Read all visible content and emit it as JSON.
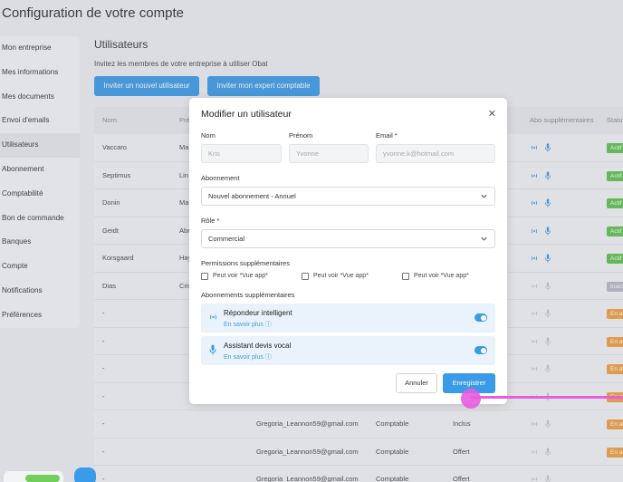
{
  "page_title": "Configuration de votre compte",
  "sidebar": {
    "items": [
      {
        "label": "Mon entreprise"
      },
      {
        "label": "Mes informations"
      },
      {
        "label": "Mes documents"
      },
      {
        "label": "Envoi d'emails"
      },
      {
        "label": "Utilisateurs"
      },
      {
        "label": "Abonnement"
      },
      {
        "label": "Comptabilité"
      },
      {
        "label": "Bon de commande"
      },
      {
        "label": "Banques"
      },
      {
        "label": "Compte"
      },
      {
        "label": "Notifications"
      },
      {
        "label": "Préférences"
      }
    ]
  },
  "main": {
    "title": "Utilisateurs",
    "subtitle": "Invitez les membres de votre entreprise à utiliser Obat",
    "invite_user_label": "Inviter un nouvel utilisateur",
    "invite_expert_label": "Inviter mon expert comptable"
  },
  "table": {
    "headers": {
      "nom": "Nom",
      "prenom": "Pré",
      "abo": "Abo supplémentaires",
      "statut": "Statu"
    },
    "rows": [
      {
        "nom": "Vaccaro",
        "prenom": "Ma",
        "email": "",
        "role": "",
        "abo": "",
        "statut": "Actif"
      },
      {
        "nom": "Septimus",
        "prenom": "Lin",
        "email": "",
        "role": "",
        "abo": "",
        "statut": "Actif"
      },
      {
        "nom": "Donin",
        "prenom": "Ma",
        "email": "",
        "role": "",
        "abo": "",
        "statut": "Actif"
      },
      {
        "nom": "Geidt",
        "prenom": "Abr",
        "email": "",
        "role": "",
        "abo": "",
        "statut": "Actif"
      },
      {
        "nom": "Korsgaard",
        "prenom": "Hay",
        "email": "",
        "role": "",
        "abo": "",
        "statut": "Actif"
      },
      {
        "nom": "Dias",
        "prenom": "Cris",
        "email": "",
        "role": "",
        "abo": "",
        "statut": "Inact"
      },
      {
        "nom": "-",
        "prenom": "",
        "email": "",
        "role": "",
        "abo": "",
        "statut": "En at"
      },
      {
        "nom": "-",
        "prenom": "",
        "email": "",
        "role": "",
        "abo": "",
        "statut": "En at"
      },
      {
        "nom": "-",
        "prenom": "",
        "email": "",
        "role": "",
        "abo": "",
        "statut": "En at"
      },
      {
        "nom": "-",
        "prenom": "",
        "email": "",
        "role": "",
        "abo": "",
        "statut": "En at"
      },
      {
        "nom": "-",
        "prenom": "",
        "email": "Gregoria_Leannon59@gmail.com",
        "role": "Comptable",
        "abo": "Inclus",
        "statut": "En at"
      },
      {
        "nom": "-",
        "prenom": "",
        "email": "Gregoria_Leannon59@gmail.com",
        "role": "Comptable",
        "abo": "Offert",
        "statut": "En at"
      },
      {
        "nom": "-",
        "prenom": "",
        "email": "Gregoria_Leannon59@gmail.com",
        "role": "Comptable",
        "abo": "Offert",
        "statut": ""
      }
    ]
  },
  "modal": {
    "title": "Modifier un utilisateur",
    "nom_label": "Nom",
    "nom_value": "Kris",
    "prenom_label": "Prénom",
    "prenom_value": "Yvonne",
    "email_label": "Email *",
    "email_value": "yvonne.k@hotmail.com",
    "abonnement_label": "Abonnement",
    "abonnement_value": "Nouvel abonnement - Annuel",
    "role_label": "Rôle *",
    "role_value": "Commercial",
    "permissions_label": "Permissions supplémentaires",
    "permissions": [
      "Peut voir *Vue app*",
      "Peut voir *Vue app*",
      "Peut voir *Vue app*"
    ],
    "abonnements_label": "Abonnements supplémentaires",
    "subscriptions": [
      {
        "name": "Répondeur intelligent",
        "link": "En savoir plus"
      },
      {
        "name": "Assistant devis vocal",
        "link": "En savoir plus"
      }
    ],
    "cancel_label": "Annuler",
    "save_label": "Enregistrer"
  },
  "colors": {
    "primary": "#3a9be8",
    "actif": "#5cc14e",
    "inactif": "#b7b9c6",
    "attente": "#f0a040",
    "cursor": "#e85ce0"
  }
}
